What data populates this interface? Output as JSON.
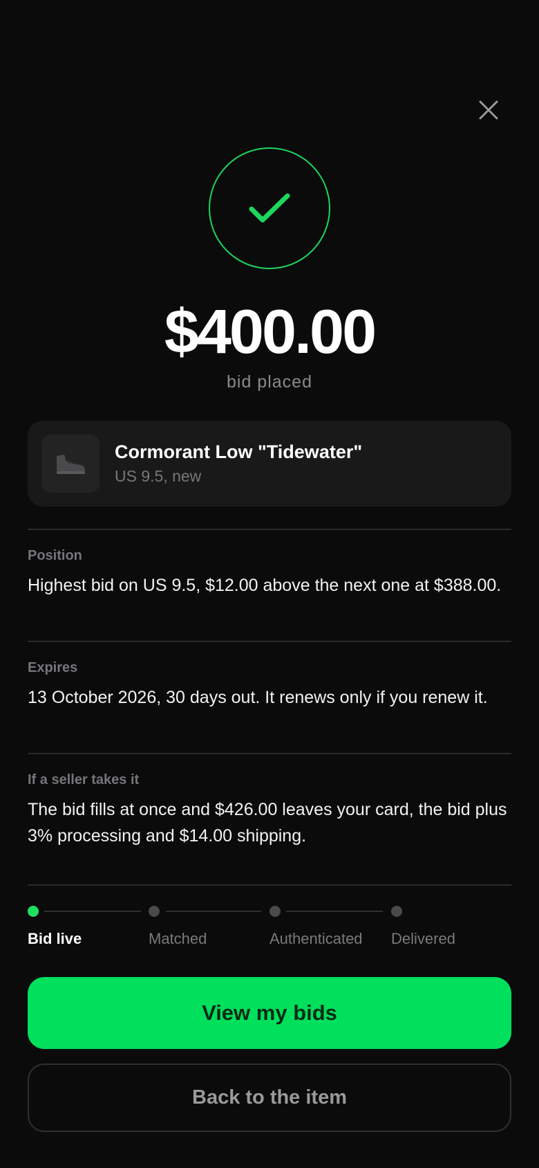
{
  "icons": {
    "close": "close-icon",
    "success": "checkmark-icon",
    "product": "sneaker-icon"
  },
  "colors": {
    "background": "#0b0b0c",
    "accent": "#00e05c",
    "success_stroke": "#1ed65c"
  },
  "confirmation": {
    "amount": "$400.00",
    "subtitle": "bid placed"
  },
  "product": {
    "name": "Cormorant Low \"Tidewater\"",
    "variant": "US 9.5, new"
  },
  "details": [
    {
      "label": "Position",
      "text": "Highest bid on US 9.5, $12.00 above the next one at $388.00."
    },
    {
      "label": "Expires",
      "text": "13 October 2026, 30 days out. It renews only if you renew it."
    },
    {
      "label": "If a seller takes it",
      "text": "The bid fills at once and $426.00 leaves your card, the bid plus 3% processing and $14.00 shipping."
    }
  ],
  "progress": {
    "current_step": 1,
    "steps": [
      {
        "label": "Bid live",
        "active": true
      },
      {
        "label": "Matched",
        "active": false
      },
      {
        "label": "Authenticated",
        "active": false
      },
      {
        "label": "Delivered",
        "active": false
      }
    ]
  },
  "actions": {
    "primary_label": "View my bids",
    "secondary_label": "Back to the item"
  }
}
